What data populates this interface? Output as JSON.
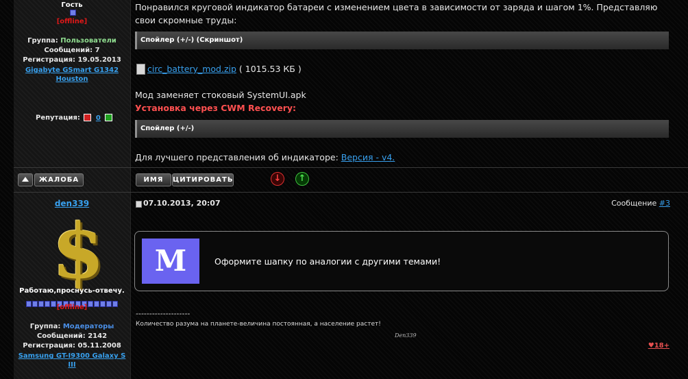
{
  "post1": {
    "user": {
      "name": "Гость",
      "status": "[offline]",
      "group_label": "Группа:",
      "group_value": "Пользователи",
      "messages": "Сообщений: 7",
      "registered": "Регистрация: 19.05.2013",
      "device": "Gigabyte GSmart G1342 Houston",
      "reputation_label": "Репутация:",
      "reputation_value": "0"
    },
    "text_intro": "Понравился круговой индикатор батареи с изменением цвета в зависимости от заряда и шагом 1%. Представляю свои скромные труды:",
    "spoiler1": "Спойлер (+/-) (Скриншот)",
    "attachment_name": "circ_battery_mod.zip",
    "attachment_size": "( 1015.53 КБ )",
    "mod_note": "Мод заменяет стоковый SystemUI.apk",
    "install_heading": "Установка через CWM Recovery:",
    "spoiler2": "Спойлер (+/-)",
    "better_view_text": "Для лучшего представления об индикаторе:",
    "better_view_link": "Версия - v4."
  },
  "toolbar": {
    "report_button": "ЖАЛОБА",
    "name_button": "ИМЯ",
    "quote_button": "ЦИТИРОВАТЬ"
  },
  "post2": {
    "user": {
      "name": "den339",
      "tagline": "Работаю,проснусь-отвечу.",
      "status": "[offline]",
      "group_label": "Группа:",
      "group_value": "Модераторы",
      "messages": "Сообщений: 2142",
      "registered": "Регистрация: 05.11.2008",
      "device": "Samsung GT-I9300 Galaxy S III"
    },
    "date": "07.10.2013, 20:07",
    "message_label": "Сообщение",
    "message_number": "#3",
    "mod_badge_letter": "M",
    "mod_notice": "Оформите шапку по аналогии с другими темами!",
    "signature_dashes": "--------------------",
    "signature_quote": "Количество разума на планете-величина постоянная, а население растет!",
    "signature_name": "Den339",
    "likes": "♥18+"
  },
  "colors": {
    "accent_link": "#38a0ee",
    "offline_red": "#e01818",
    "mod_box": "#6a63f0",
    "down_arrow": "#e03030",
    "up_arrow": "#40c040"
  }
}
